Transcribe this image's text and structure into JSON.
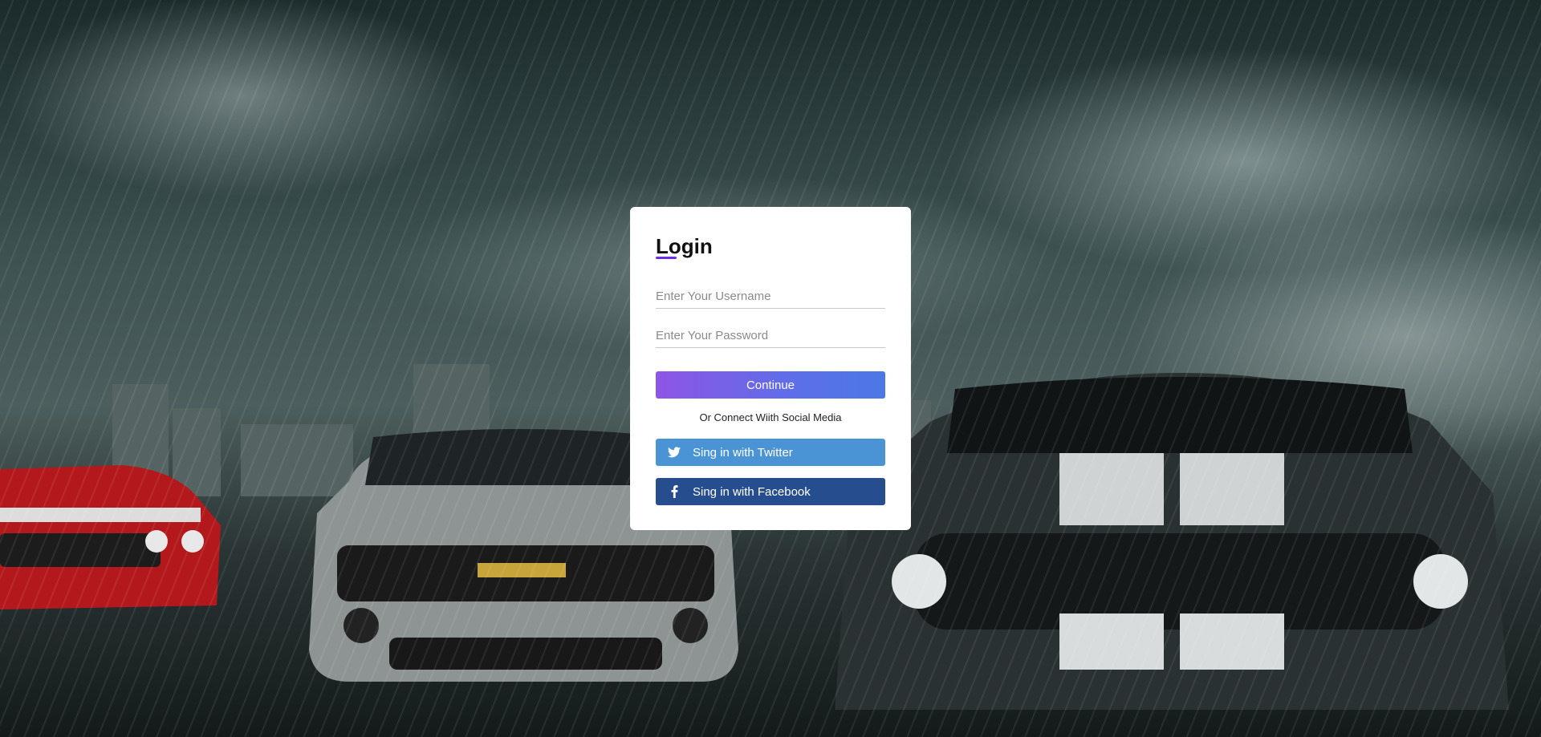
{
  "background": {
    "description_icon": "stormy-city-cars-background"
  },
  "login": {
    "title": "Login",
    "username_placeholder": "Enter Your Username",
    "password_placeholder": "Enter Your Password",
    "continue_label": "Continue",
    "social_text": "Or Connect Wiith Social Media",
    "twitter_label": "Sing in with Twitter",
    "facebook_label": "Sing in with Facebook",
    "twitter_icon": "twitter-icon",
    "facebook_icon": "facebook-icon"
  },
  "colors": {
    "accent": "#6a2de8",
    "continue_gradient_start": "#8e55e6",
    "continue_gradient_end": "#4c78e6",
    "twitter": "#4a94d6",
    "facebook": "#264d8d"
  }
}
